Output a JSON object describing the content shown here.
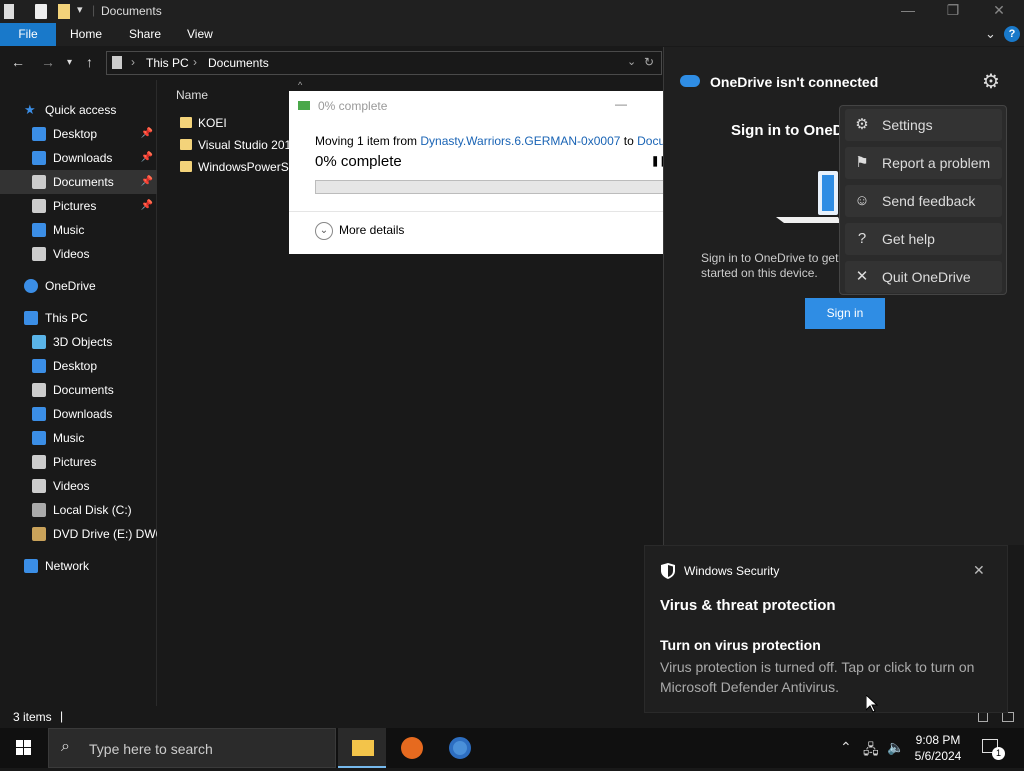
{
  "window": {
    "title": "Documents"
  },
  "ribbon": {
    "file": "File",
    "tabs": [
      "Home",
      "Share",
      "View"
    ]
  },
  "address": {
    "crumbs": [
      "This PC",
      "Documents"
    ]
  },
  "navpane": {
    "items": [
      {
        "label": "Quick access",
        "icon": "star-icon",
        "color": "#3b8ee6",
        "indent": 1,
        "pinned": false
      },
      {
        "label": "Desktop",
        "icon": "desktop-icon",
        "color": "#3b8ee6",
        "indent": 2,
        "pinned": true
      },
      {
        "label": "Downloads",
        "icon": "downloads-icon",
        "color": "#3b8ee6",
        "indent": 2,
        "pinned": true
      },
      {
        "label": "Documents",
        "icon": "documents-icon",
        "color": "#cccccc",
        "indent": 2,
        "pinned": true,
        "selected": true
      },
      {
        "label": "Pictures",
        "icon": "pictures-icon",
        "color": "#cccccc",
        "indent": 2,
        "pinned": true
      },
      {
        "label": "Music",
        "icon": "music-icon",
        "color": "#3b8ee6",
        "indent": 2,
        "pinned": false
      },
      {
        "label": "Videos",
        "icon": "videos-icon",
        "color": "#cccccc",
        "indent": 2,
        "pinned": false
      },
      {
        "label": "OneDrive",
        "icon": "onedrive-icon",
        "color": "#3b8ee6",
        "indent": 1,
        "pinned": false
      },
      {
        "label": "This PC",
        "icon": "this-pc-icon",
        "color": "#3b8ee6",
        "indent": 1,
        "pinned": false
      },
      {
        "label": "3D Objects",
        "icon": "3d-objects-icon",
        "color": "#5ab4e8",
        "indent": 2,
        "pinned": false
      },
      {
        "label": "Desktop",
        "icon": "desktop-icon",
        "color": "#3b8ee6",
        "indent": 2,
        "pinned": false
      },
      {
        "label": "Documents",
        "icon": "documents-icon",
        "color": "#cccccc",
        "indent": 2,
        "pinned": false
      },
      {
        "label": "Downloads",
        "icon": "downloads-icon",
        "color": "#3b8ee6",
        "indent": 2,
        "pinned": false
      },
      {
        "label": "Music",
        "icon": "music-icon",
        "color": "#3b8ee6",
        "indent": 2,
        "pinned": false
      },
      {
        "label": "Pictures",
        "icon": "pictures-icon",
        "color": "#cccccc",
        "indent": 2,
        "pinned": false
      },
      {
        "label": "Videos",
        "icon": "videos-icon",
        "color": "#cccccc",
        "indent": 2,
        "pinned": false
      },
      {
        "label": "Local Disk (C:)",
        "icon": "local-disk-icon",
        "color": "#aaaaaa",
        "indent": 2,
        "pinned": false
      },
      {
        "label": "DVD Drive (E:) DW6",
        "icon": "dvd-drive-icon",
        "color": "#c9a25a",
        "indent": 2,
        "pinned": false
      },
      {
        "label": "Network",
        "icon": "network-icon",
        "color": "#3b8ee6",
        "indent": 1,
        "pinned": false
      }
    ]
  },
  "content": {
    "column_name": "Name",
    "files": [
      "KOEI",
      "Visual Studio 2019",
      "WindowsPowerShell"
    ]
  },
  "status": {
    "items": "3 items"
  },
  "copy_dialog": {
    "title": "0% complete",
    "moving_prefix": "Moving 1 item from ",
    "source": "Dynasty.Warriors.6.GERMAN-0x0007",
    "to": " to ",
    "dest": "Documents",
    "percent_text": "0% complete",
    "progress": 0,
    "more_details": "More details"
  },
  "onedrive": {
    "header": "OneDrive isn't connected",
    "sign_in_title": "Sign in to OneDrive",
    "description": "Sign in to OneDrive to get started on this device.",
    "sign_in_button": "Sign in",
    "menu": [
      {
        "label": "Settings",
        "icon": "gear-icon"
      },
      {
        "label": "Report a problem",
        "icon": "flag-icon"
      },
      {
        "label": "Send feedback",
        "icon": "feedback-icon"
      },
      {
        "label": "Get help",
        "icon": "help-icon"
      },
      {
        "label": "Quit OneDrive",
        "icon": "close-icon"
      }
    ]
  },
  "toast": {
    "app": "Windows Security",
    "heading": "Virus & threat protection",
    "title": "Turn on virus protection",
    "body": "Virus protection is turned off. Tap or click to turn on Microsoft Defender Antivirus."
  },
  "taskbar": {
    "search_placeholder": "Type here to search",
    "time": "9:08 PM",
    "date": "5/6/2024",
    "notification_count": "1"
  }
}
